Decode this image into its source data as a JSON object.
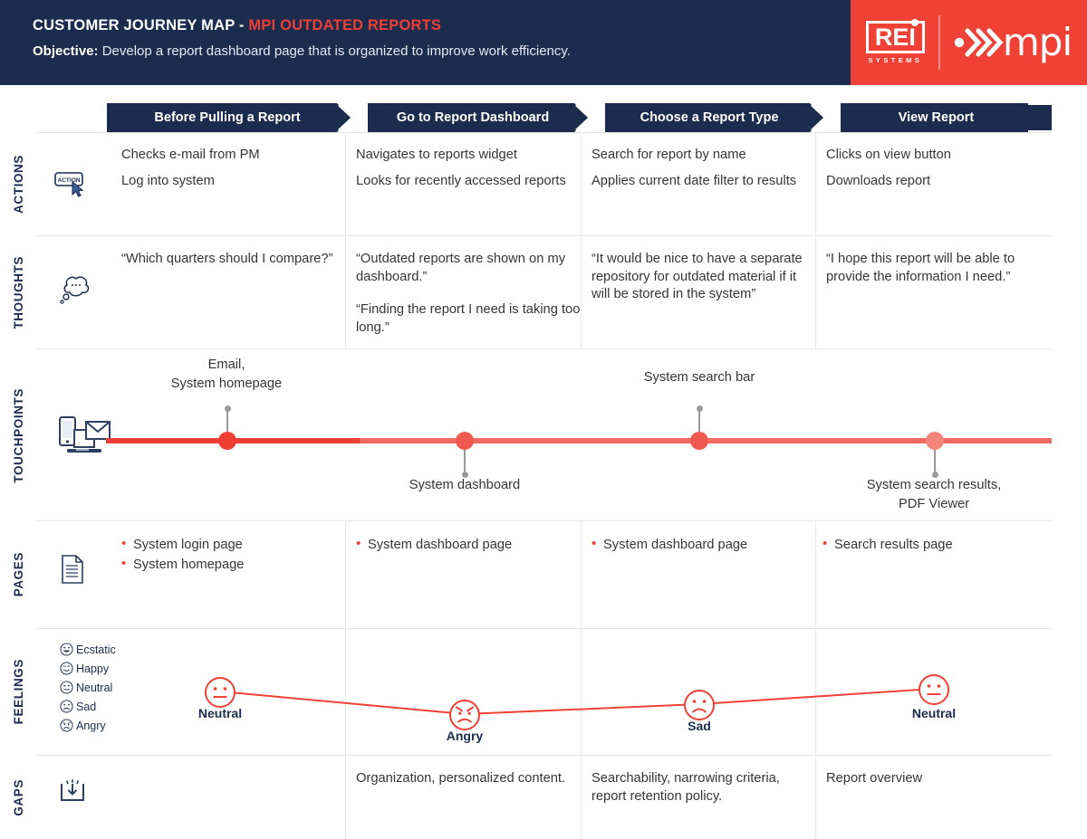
{
  "header": {
    "title_main": "CUSTOMER JOURNEY MAP - ",
    "title_accent": "MPI OUTDATED REPORTS",
    "objective_label": "Objective:",
    "objective_text": " Develop a report dashboard page that is organized to improve work efficiency.",
    "logo": {
      "rei_letters": "REI",
      "rei_subtitle": "SYSTEMS",
      "mpi_text": "mpi"
    },
    "colors": {
      "navy": "#1b2c4e",
      "red": "#ef4136",
      "accent_red": "#ef3e33"
    }
  },
  "phases": [
    {
      "label": "Before Pulling a Report"
    },
    {
      "label": "Go to Report Dashboard"
    },
    {
      "label": "Choose a Report Type"
    },
    {
      "label": "View Report"
    }
  ],
  "rows": {
    "actions": {
      "label": "ACTIONS",
      "icon": "action-button-cursor-icon",
      "icon_text": "ACTION",
      "cells": [
        [
          "Checks e-mail from PM",
          "Log into system"
        ],
        [
          "Navigates to reports widget",
          "Looks for recently accessed reports"
        ],
        [
          "Search for report by name",
          "Applies current date filter to results"
        ],
        [
          "Clicks on view button",
          "Downloads report"
        ]
      ]
    },
    "thoughts": {
      "label": "THOUGHTS",
      "icon": "thought-bubble-icon",
      "cells": [
        [
          "“Which quarters should I compare?”"
        ],
        [
          "“Outdated reports are shown on my dashboard.”",
          "“Finding the report I need is taking too long.”"
        ],
        [
          "“It would be nice to have a separate repository for outdated material if it will be stored in the system”"
        ],
        [
          "“I hope this report will be able to provide the information I need.”"
        ]
      ]
    },
    "touchpoints": {
      "label": "TOUCHPOINTS",
      "icon": "phone-laptop-email-icon",
      "points": [
        {
          "label": "Email,\nSystem homepage",
          "position": "above",
          "color": "#ef3e33"
        },
        {
          "label": "System dashboard",
          "position": "below",
          "color": "#ef6a60"
        },
        {
          "label": "System search bar",
          "position": "above",
          "color": "#ef5a50"
        },
        {
          "label": "System search results,\nPDF Viewer",
          "position": "below",
          "color": "#f4857d"
        }
      ]
    },
    "pages": {
      "label": "PAGES",
      "icon": "document-icon",
      "cells": [
        [
          "System login page",
          "System homepage"
        ],
        [
          "System dashboard page"
        ],
        [
          "System dashboard page"
        ],
        [
          "Search results page"
        ]
      ]
    },
    "feelings": {
      "label": "FEELINGS",
      "legend": [
        {
          "face": "ecstatic",
          "text": "Ecstatic"
        },
        {
          "face": "happy",
          "text": "Happy"
        },
        {
          "face": "neutral",
          "text": "Neutral"
        },
        {
          "face": "sad",
          "text": "Sad"
        },
        {
          "face": "angry",
          "text": "Angry"
        }
      ],
      "points": [
        {
          "face": "neutral",
          "label": "Neutral"
        },
        {
          "face": "angry",
          "label": "Angry"
        },
        {
          "face": "sad",
          "label": "Sad"
        },
        {
          "face": "neutral",
          "label": "Neutral"
        }
      ]
    },
    "gaps": {
      "label": "GAPS",
      "icon": "gap-tray-icon",
      "cells": [
        [
          ""
        ],
        [
          "Organization, personalized content."
        ],
        [
          "Searchability, narrowing criteria, report retention policy."
        ],
        [
          "Report overview"
        ]
      ]
    }
  }
}
